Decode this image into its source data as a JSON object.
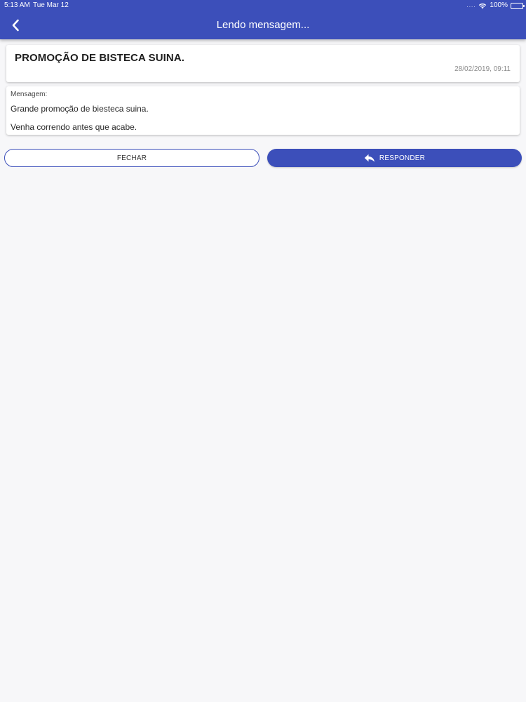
{
  "status_bar": {
    "time": "5:13 AM",
    "date": "Tue Mar 12",
    "signal": "....",
    "battery": "100%",
    "battery_level": 100
  },
  "header": {
    "title": "Lendo mensagem...",
    "back_icon": "chevron-left-icon",
    "background_color": "#3c4fba"
  },
  "message": {
    "title": "PROMOÇÃO DE BISTECA SUINA.",
    "datetime": "28/02/2019, 09:11",
    "label": "Mensagem:",
    "lines": [
      "Grande promoção de biesteca suina.",
      "Venha correndo antes que acabe."
    ]
  },
  "actions": {
    "close_label": "FECHAR",
    "reply_label": "RESPONDER",
    "reply_icon": "reply-icon"
  }
}
